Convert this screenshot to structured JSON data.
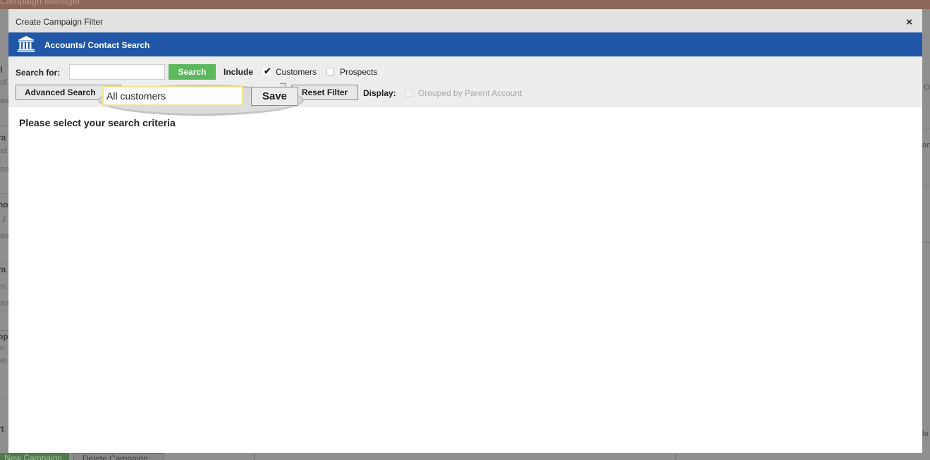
{
  "background": {
    "topbar_text": "Campaign Manager",
    "left_items": [
      {
        "bold": "ll",
        "sub1": "od",
        "sub2": "rea"
      },
      {
        "bold": "ra",
        "sub1": "od",
        "sub2": "rea"
      },
      {
        "bold": "no",
        "sub1": "i J",
        "sub2": "rea"
      },
      {
        "bold": "ra",
        "sub1": "ec",
        "sub2": "rea"
      },
      {
        "bold": "op",
        "sub1": "er",
        "sub2": "yo"
      },
      {
        "bold": "rt",
        "sub1": "",
        "sub2": ""
      }
    ],
    "right_fragments": [
      "O",
      "an",
      "la"
    ],
    "buttons": {
      "new_campaign": "New Campaign",
      "delete_campaign": "Delete Campaign"
    }
  },
  "modal": {
    "title": "Create Campaign Filter",
    "close_glyph": "×",
    "section_title": "Accounts/ Contact Search",
    "toolbar": {
      "search_label": "Search for:",
      "search_value": "",
      "search_button": "Search",
      "include_label": "Include",
      "customers_label": "Customers",
      "customers_checked": true,
      "prospects_label": "Prospects",
      "prospects_checked": false,
      "advanced_search_button": "Advanced Search",
      "filter_name_value": "All customers",
      "save_button": "Save",
      "reset_filter_button": "Reset Filter",
      "display_label": "Display:",
      "grouped_label": "Grouped by Parent Account"
    },
    "message": "Please select your search criteria"
  },
  "colors": {
    "header_blue": "#2157a6",
    "search_green": "#5cb85c",
    "highlight_input_border": "#f0e291"
  },
  "icons": {
    "section_icon": "bank-icon",
    "close": "close-icon",
    "check": "checkmark-icon"
  }
}
